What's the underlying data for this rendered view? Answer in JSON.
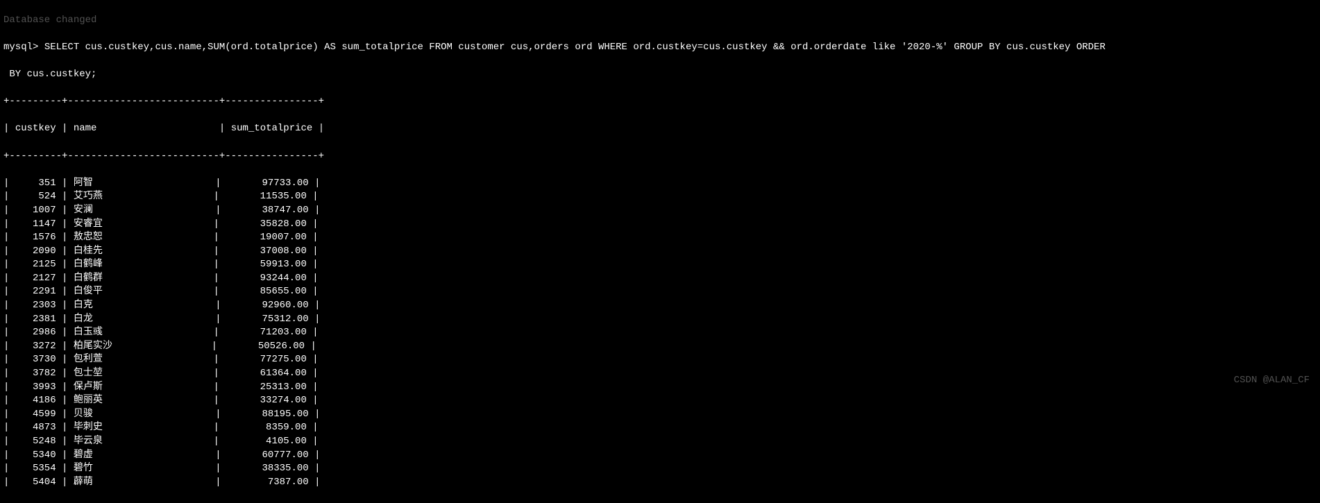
{
  "faded_text": "Database changed",
  "prompt_prefix": "mysql> ",
  "query_line1": "SELECT cus.custkey,cus.name,SUM(ord.totalprice) AS sum_totalprice FROM customer cus,orders ord WHERE ord.custkey=cus.custkey && ord.orderdate like '2020-%' GROUP BY cus.custkey ORDER",
  "query_line2": " BY cus.custkey;",
  "separator": "+---------+--------------------------+----------------+",
  "headers": {
    "custkey": "custkey",
    "name": "name",
    "sum_totalprice": "sum_totalprice"
  },
  "rows": [
    {
      "custkey": "351",
      "name": "阿智",
      "sum": "97733.00"
    },
    {
      "custkey": "524",
      "name": "艾巧燕",
      "sum": "11535.00"
    },
    {
      "custkey": "1007",
      "name": "安澜",
      "sum": "38747.00"
    },
    {
      "custkey": "1147",
      "name": "安睿宜",
      "sum": "35828.00"
    },
    {
      "custkey": "1576",
      "name": "敖忠恕",
      "sum": "19007.00"
    },
    {
      "custkey": "2090",
      "name": "白桂先",
      "sum": "37008.00"
    },
    {
      "custkey": "2125",
      "name": "白鹤峰",
      "sum": "59913.00"
    },
    {
      "custkey": "2127",
      "name": "白鹤群",
      "sum": "93244.00"
    },
    {
      "custkey": "2291",
      "name": "白俊平",
      "sum": "85655.00"
    },
    {
      "custkey": "2303",
      "name": "白克",
      "sum": "92960.00"
    },
    {
      "custkey": "2381",
      "name": "白龙",
      "sum": "75312.00"
    },
    {
      "custkey": "2986",
      "name": "白玉彧",
      "sum": "71203.00"
    },
    {
      "custkey": "3272",
      "name": "柏尾实沙",
      "sum": "50526.00"
    },
    {
      "custkey": "3730",
      "name": "包利萱",
      "sum": "77275.00"
    },
    {
      "custkey": "3782",
      "name": "包士堃",
      "sum": "61364.00"
    },
    {
      "custkey": "3993",
      "name": "保卢斯",
      "sum": "25313.00"
    },
    {
      "custkey": "4186",
      "name": "鲍丽英",
      "sum": "33274.00"
    },
    {
      "custkey": "4599",
      "name": "贝骏",
      "sum": "88195.00"
    },
    {
      "custkey": "4873",
      "name": "毕刺史",
      "sum": "8359.00"
    },
    {
      "custkey": "5248",
      "name": "毕云泉",
      "sum": "4105.00"
    },
    {
      "custkey": "5340",
      "name": "碧虚",
      "sum": "60777.00"
    },
    {
      "custkey": "5354",
      "name": "碧竹",
      "sum": "38335.00"
    },
    {
      "custkey": "5404",
      "name": "薜萌",
      "sum": "7387.00"
    }
  ],
  "watermark": "CSDN @ALAN_CF"
}
